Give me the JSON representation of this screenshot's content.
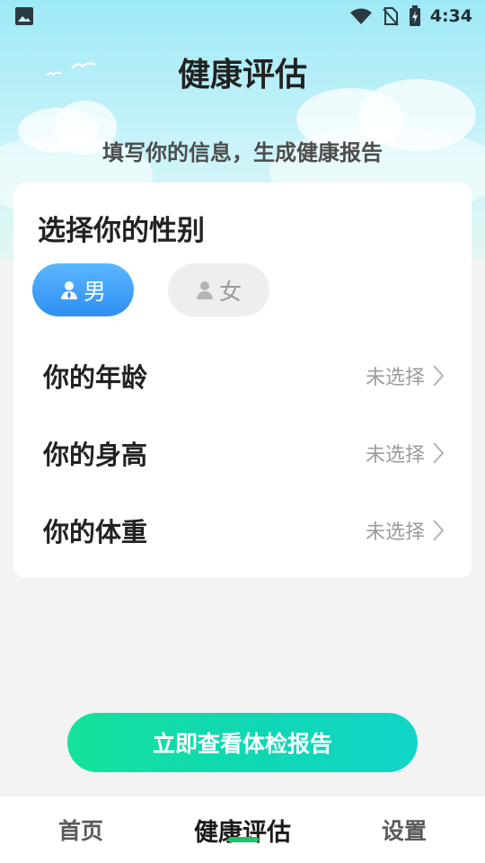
{
  "statusbar": {
    "time": "4:34",
    "icons": [
      "image-icon",
      "wifi-icon",
      "no-sim-icon",
      "battery-charging-icon"
    ]
  },
  "header": {
    "title": "健康评估",
    "subtitle": "填写你的信息，生成健康报告"
  },
  "gender": {
    "title": "选择你的性别",
    "male_label": "男",
    "female_label": "女",
    "selected": "male"
  },
  "fields": {
    "age": {
      "label": "你的年龄",
      "value": "未选择"
    },
    "height": {
      "label": "你的身高",
      "value": "未选择"
    },
    "weight": {
      "label": "你的体重",
      "value": "未选择"
    }
  },
  "cta": {
    "label": "立即查看体检报告"
  },
  "tabs": {
    "home": "首页",
    "assessment": "健康评估",
    "settings": "设置",
    "active": "assessment"
  },
  "colors": {
    "primary_blue": "#3a9bf7",
    "cta_green": "#14e29c",
    "cta_teal": "#10d6c9",
    "tab_indicator": "#1fc46a"
  }
}
